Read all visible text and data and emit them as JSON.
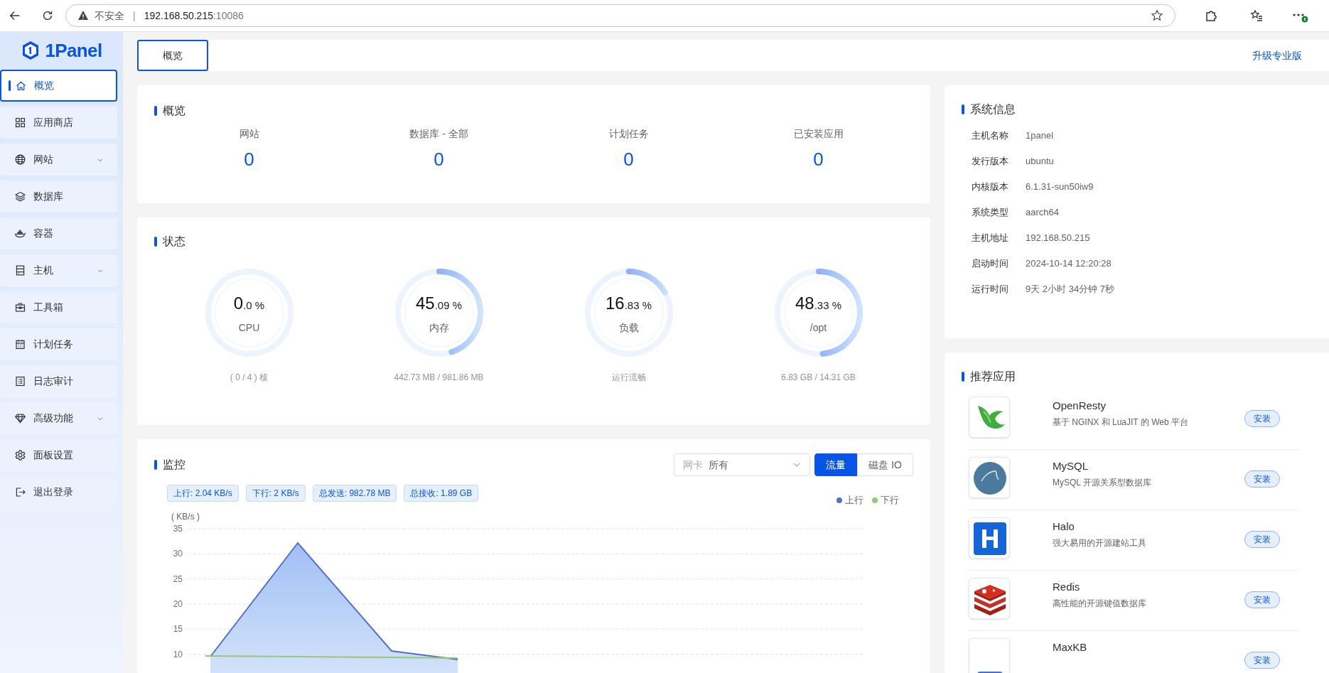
{
  "browser": {
    "security": "不安全",
    "separator": "|",
    "url_host": "192.168.50.215",
    "url_port": ":10086"
  },
  "sidebar": {
    "logo": "1Panel",
    "items": [
      {
        "label": "概览",
        "selected": true,
        "expandable": false
      },
      {
        "label": "应用商店",
        "selected": false,
        "expandable": false
      },
      {
        "label": "网站",
        "selected": false,
        "expandable": true
      },
      {
        "label": "数据库",
        "selected": false,
        "expandable": false
      },
      {
        "label": "容器",
        "selected": false,
        "expandable": false
      },
      {
        "label": "主机",
        "selected": false,
        "expandable": true
      },
      {
        "label": "工具箱",
        "selected": false,
        "expandable": false
      },
      {
        "label": "计划任务",
        "selected": false,
        "expandable": false
      },
      {
        "label": "日志审计",
        "selected": false,
        "expandable": false
      },
      {
        "label": "高级功能",
        "selected": false,
        "expandable": true
      },
      {
        "label": "面板设置",
        "selected": false,
        "expandable": false
      },
      {
        "label": "退出登录",
        "selected": false,
        "expandable": false
      }
    ]
  },
  "tabs": [
    {
      "label": "概览",
      "selected": true
    }
  ],
  "upgrade_link": "升级专业版",
  "overview": {
    "title": "概览",
    "stats": [
      {
        "label": "网站",
        "value": "0"
      },
      {
        "label": "数据库 - 全部",
        "value": "0"
      },
      {
        "label": "计划任务",
        "value": "0"
      },
      {
        "label": "已安装应用",
        "value": "0"
      }
    ]
  },
  "status": {
    "title": "状态",
    "gauges": [
      {
        "value_main": "0",
        "value_rest": ".0 %",
        "label": "CPU",
        "level": 0,
        "detail": "( 0 / 4 ) 核"
      },
      {
        "value_main": "45",
        "value_rest": ".09 %",
        "label": "内存",
        "level": 0.4509,
        "detail": "442.73 MB / 981.86 MB"
      },
      {
        "value_main": "16",
        "value_rest": ".83 %",
        "label": "负载",
        "level": 0.1683,
        "detail": "运行流畅"
      },
      {
        "value_main": "48",
        "value_rest": ".33 %",
        "label": "/opt",
        "level": 0.4833,
        "detail": "6.83 GB / 14.31 GB"
      }
    ]
  },
  "monitor": {
    "title": "监控",
    "select_label": "网卡",
    "select_value": "所有",
    "modes": [
      {
        "label": "流量",
        "selected": true
      },
      {
        "label": "磁盘 IO",
        "selected": false
      }
    ],
    "tags": [
      "上行: 2.04 KB/s",
      "下行: 2 KB/s",
      "总发送: 982.78 MB",
      "总接收: 1.89 GB"
    ],
    "legend": [
      {
        "label": "上行",
        "color": "#5470c6"
      },
      {
        "label": "下行",
        "color": "#91cc75"
      }
    ],
    "unit": "( KB/s )",
    "y_labels": [
      "35",
      "30",
      "25",
      "20",
      "15",
      "10"
    ]
  },
  "system_info": {
    "title": "系统信息",
    "rows": [
      {
        "label": "主机名称",
        "value": "1panel"
      },
      {
        "label": "发行版本",
        "value": "ubuntu"
      },
      {
        "label": "内核版本",
        "value": "6.1.31-sun50iw9"
      },
      {
        "label": "系统类型",
        "value": "aarch64"
      },
      {
        "label": "主机地址",
        "value": "192.168.50.215"
      },
      {
        "label": "启动时间",
        "value": "2024-10-14 12:20:28"
      },
      {
        "label": "运行时间",
        "value": "9天 2小时 34分钟 7秒"
      }
    ]
  },
  "recommended": {
    "title": "推荐应用",
    "apps": [
      {
        "name": "OpenResty",
        "description": "基于 NGINX 和 LuaJIT 的 Web 平台",
        "button": "安装"
      },
      {
        "name": "MySQL",
        "description": "MySQL 开源关系型数据库",
        "button": "安装"
      },
      {
        "name": "Halo",
        "description": "强大易用的开源建站工具",
        "button": "安装"
      },
      {
        "name": "Redis",
        "description": "高性能的开源键值数据库",
        "button": "安装"
      },
      {
        "name": "MaxKB",
        "button": "安装"
      }
    ]
  }
}
